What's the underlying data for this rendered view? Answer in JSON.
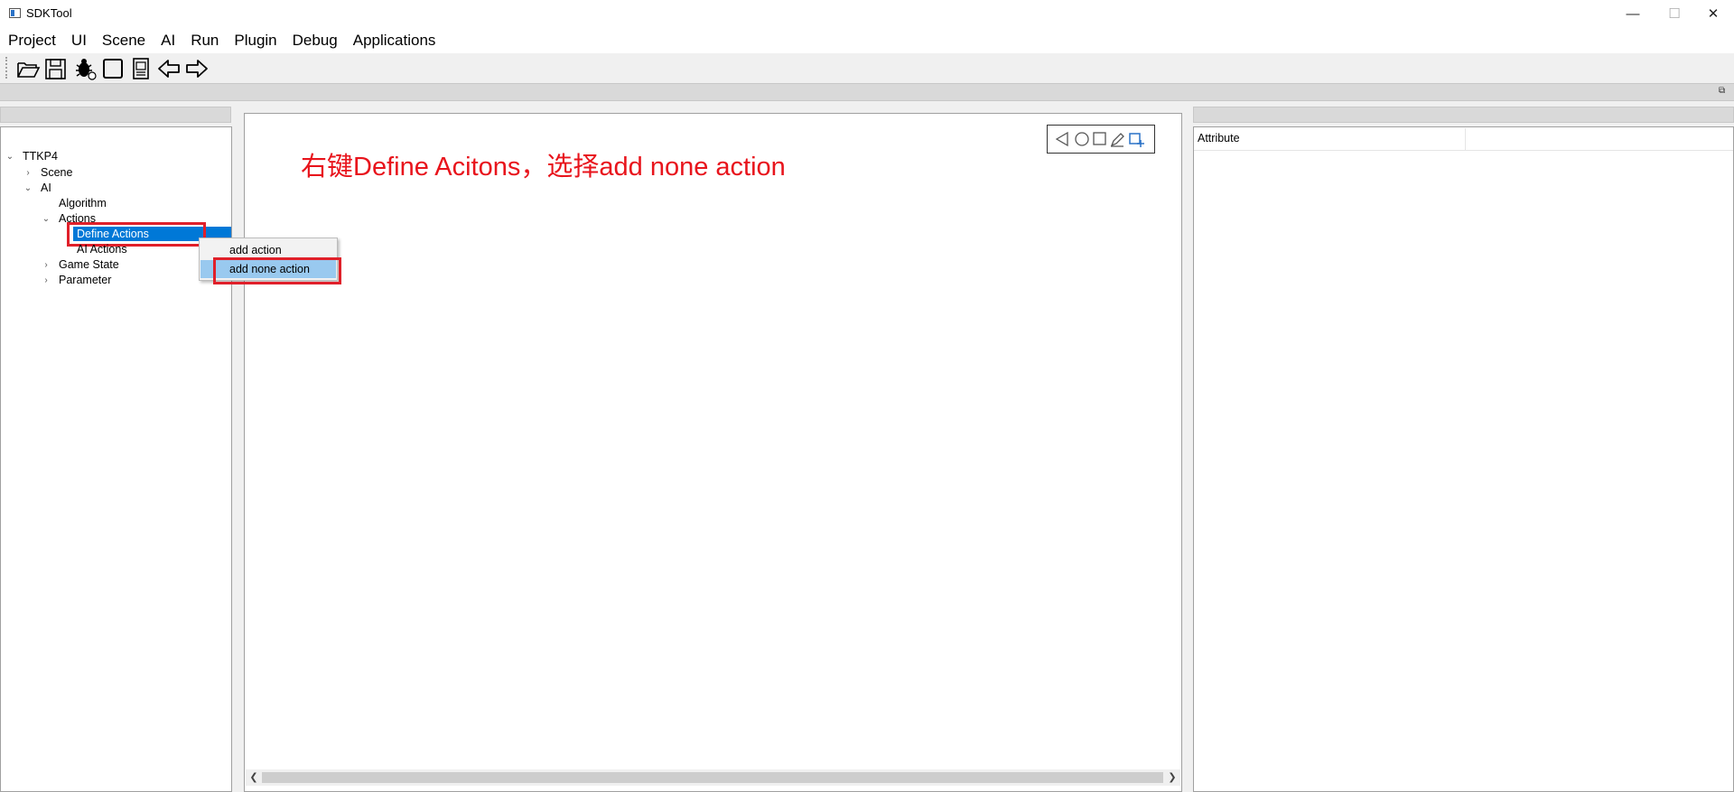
{
  "window": {
    "title": "SDKTool",
    "minimize_glyph": "—",
    "maximize_glyph": "☐",
    "close_glyph": "✕"
  },
  "menubar": {
    "items": [
      "Project",
      "UI",
      "Scene",
      "AI",
      "Run",
      "Plugin",
      "Debug",
      "Applications"
    ]
  },
  "toolbar": {
    "buttons": [
      "open-folder-icon",
      "save-icon",
      "debug-bug-icon",
      "stop-square-icon",
      "image-file-icon",
      "back-arrow-icon",
      "forward-arrow-icon"
    ]
  },
  "tree": {
    "root": "TTKP4",
    "items": [
      {
        "label": "Scene",
        "level": 1,
        "expanded": false
      },
      {
        "label": "AI",
        "level": 1,
        "expanded": true
      },
      {
        "label": "Algorithm",
        "level": 2
      },
      {
        "label": "Actions",
        "level": 2,
        "expanded": true
      },
      {
        "label": "Define Actions",
        "level": 3,
        "selected": true
      },
      {
        "label": "AI Actions",
        "level": 3
      },
      {
        "label": "Game State",
        "level": 2,
        "expanded": false
      },
      {
        "label": "Parameter",
        "level": 2,
        "expanded": false
      }
    ]
  },
  "context_menu": {
    "items": [
      "add action",
      "add none action"
    ],
    "highlighted": "add none action"
  },
  "canvas": {
    "annotation": "右键Define Acitons，选择add none action",
    "shape_tools": [
      "triangle-left-icon",
      "circle-icon",
      "square-icon",
      "edit-pen-icon",
      "crop-select-icon"
    ]
  },
  "attribute_panel": {
    "column_header": "Attribute"
  },
  "colors": {
    "selection_blue": "#0078d7",
    "menu_highlight": "#99c9ef",
    "annotation_red": "#e8141c"
  }
}
